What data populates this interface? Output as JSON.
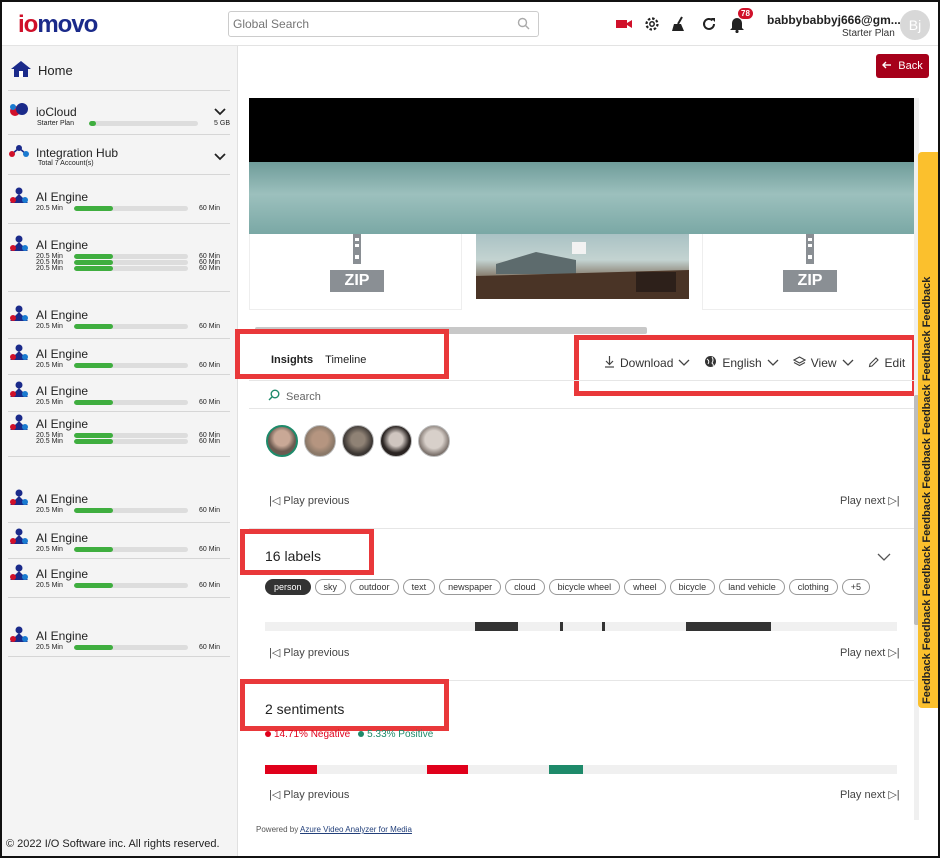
{
  "header": {
    "logo_text": "iomovo",
    "search_placeholder": "Global Search",
    "notification_count": "78",
    "user_email": "babbybabbyj666@gm...",
    "user_plan": "Starter Plan",
    "avatar_initials": "Bj"
  },
  "sidebar": {
    "home_label": "Home",
    "iocloud": {
      "title": "ioCloud",
      "plan": "Starter Plan",
      "limit": "5 GB",
      "used_fraction": 0.07
    },
    "integration_hub": {
      "title": "Integration Hub",
      "subtitle": "Total 7 Account(s)"
    },
    "ai_engine_title": "AI Engine",
    "ai_engine_used": "20.5 Min",
    "ai_engine_limit": "60 Min",
    "ai_engine_used_fraction": 0.34,
    "copyright": "© 2022 I/O Software inc. All rights reserved."
  },
  "main": {
    "back_label": "Back",
    "tabs": [
      {
        "label": "Insights",
        "active": true
      },
      {
        "label": "Timeline",
        "active": false
      }
    ],
    "toolbar": {
      "download": "Download",
      "language": "English",
      "view": "View",
      "edit": "Edit"
    },
    "search_placeholder": "Search",
    "play_previous": "Play previous",
    "play_next": "Play next",
    "labels_section": {
      "title": "16 labels",
      "chips": [
        "person",
        "sky",
        "outdoor",
        "text",
        "newspaper",
        "cloud",
        "bicycle wheel",
        "wheel",
        "bicycle",
        "land vehicle",
        "clothing",
        "+5"
      ]
    },
    "sentiments_section": {
      "title": "2 sentiments",
      "negative": "14.71% Negative",
      "positive": "5.33% Positive"
    },
    "powered_by_prefix": "Powered by",
    "powered_by_link": "Azure Video Analyzer for Media",
    "zip_label": "ZIP",
    "feedback_text": "Feedback Feedback Feedback Feedback Feedback Feedback Feedback Feedback"
  },
  "colors": {
    "brand_red": "#a6001a",
    "highlight_red": "#e9383a",
    "progress_green": "#3fae3f",
    "negative_red": "#e0001b",
    "positive_teal": "#1e8a6a",
    "feedback_yellow": "#fbc02d"
  }
}
